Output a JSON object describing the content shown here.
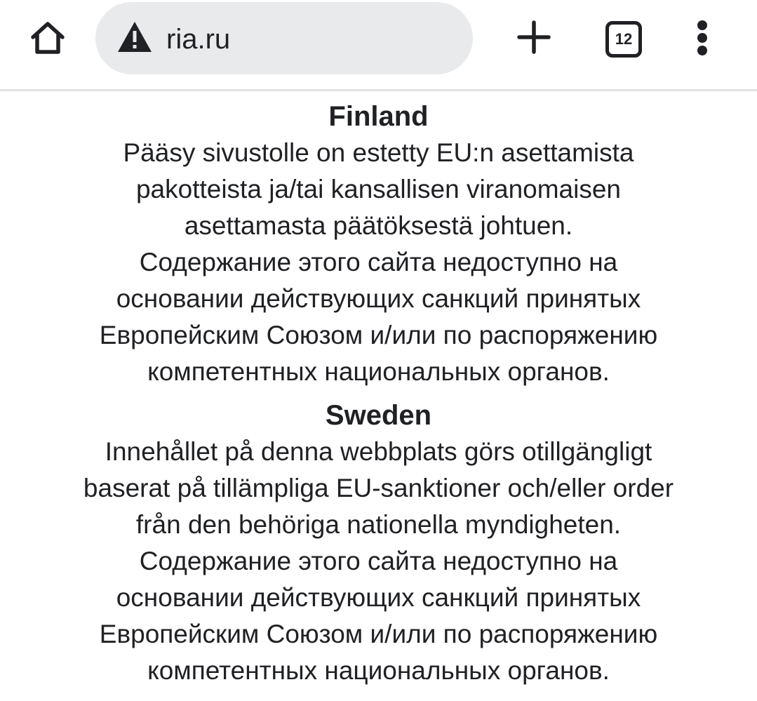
{
  "toolbar": {
    "home_icon": "home-icon",
    "security_icon": "warning-triangle-icon",
    "url": "ria.ru",
    "new_tab_icon": "plus-icon",
    "tab_count": "12",
    "menu_icon": "more-vert-icon"
  },
  "sections": [
    {
      "heading": "Finland",
      "lines": [
        "Pääsy sivustolle on estetty EU:n asettamista",
        "pakotteista ja/tai kansallisen viranomaisen",
        "asettamasta päätöksestä johtuen.",
        "Содержание этого сайта недоступно на",
        "основании действующих санкций принятых",
        "Европейским Союзом и/или по распоряжению",
        "компетентных национальных органов."
      ]
    },
    {
      "heading": "Sweden",
      "lines": [
        "Innehållet på denna webbplats görs otillgängligt",
        "baserat på tillämpliga EU-sanktioner och/eller order",
        "från den behöriga nationella myndigheten.",
        "Содержание этого сайта недоступно на",
        "основании действующих санкций принятых",
        "Европейским Союзом и/или по распоряжению",
        "компетентных национальных органов."
      ]
    }
  ]
}
